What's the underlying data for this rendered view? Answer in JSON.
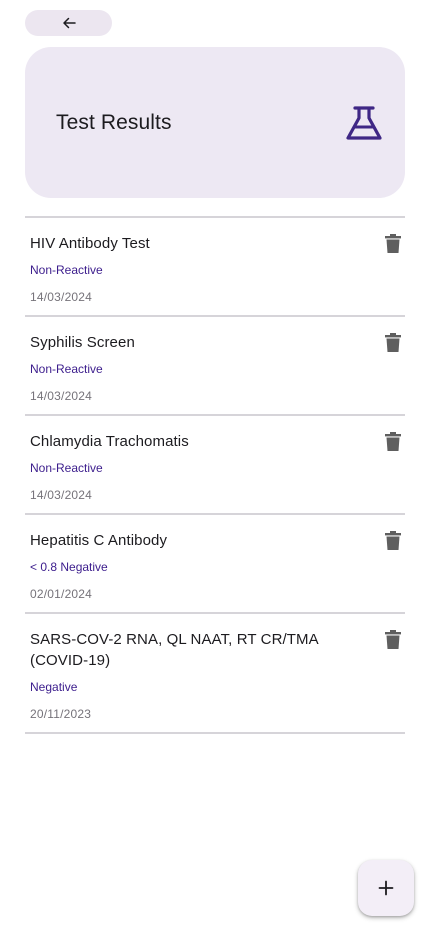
{
  "header": {
    "title": "Test Results",
    "accent_color": "#3f2785",
    "card_color": "#ede8f3"
  },
  "icons": {
    "back": "arrow-left-icon",
    "header": "flask-icon",
    "delete": "trash-icon",
    "fab": "plus-icon"
  },
  "results": [
    {
      "name": "HIV Antibody Test",
      "value": "Non-Reactive",
      "date": "14/03/2024"
    },
    {
      "name": "Syphilis Screen",
      "value": "Non-Reactive",
      "date": "14/03/2024"
    },
    {
      "name": "Chlamydia Trachomatis",
      "value": "Non-Reactive",
      "date": "14/03/2024"
    },
    {
      "name": "Hepatitis C Antibody",
      "value": "< 0.8 Negative",
      "date": "02/01/2024"
    },
    {
      "name": "SARS-COV-2 RNA, QL NAAT, RT CR/TMA (COVID-19)",
      "value": "Negative",
      "date": "20/11/2023"
    }
  ]
}
